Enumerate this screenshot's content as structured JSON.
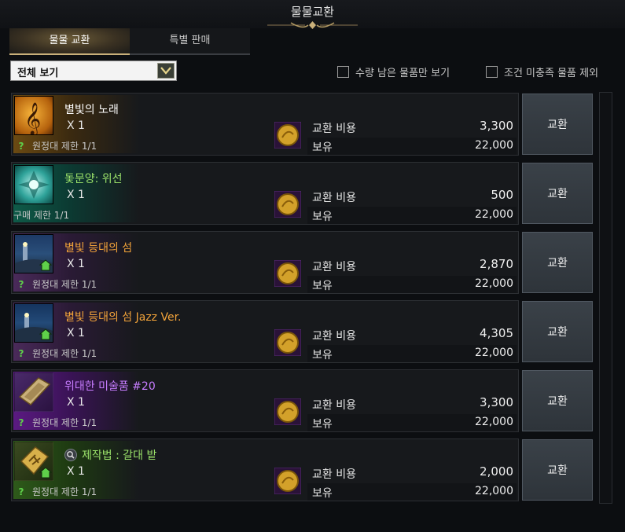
{
  "window": {
    "title": "물물교환"
  },
  "tabs": [
    {
      "label": "물물 교환",
      "active": true
    },
    {
      "label": "특별 판매",
      "active": false
    }
  ],
  "filter": {
    "selected": "전체 보기",
    "checkbox_remaining": "수량 남은 물품만 보기",
    "checkbox_exclude": "조건 미충족 물품 제외"
  },
  "items": [
    {
      "name": "별빛의 노래",
      "qty": "X 1",
      "limit": "원정대 제한 1/1",
      "grade": "legend",
      "name_color": "#ffffff",
      "cost_label": "교환 비용",
      "cost": "3,300",
      "own_label": "보유",
      "owned": "22,000",
      "button": "교환",
      "icon": "treble-clef-icon"
    },
    {
      "name": "돛문양: 위선",
      "qty": "X 1",
      "limit": "구매 제한 1/1",
      "grade": "rare",
      "name_color": "#9be26a",
      "cost_label": "교환 비용",
      "cost": "500",
      "own_label": "보유",
      "owned": "22,000",
      "button": "교환",
      "icon": "sail-pattern-icon"
    },
    {
      "name": "별빛 등대의 섬",
      "qty": "X 1",
      "limit": "원정대 제한 1/1",
      "grade": "epic",
      "name_color": "#f2a33a",
      "cost_label": "교환 비용",
      "cost": "2,870",
      "own_label": "보유",
      "owned": "22,000",
      "button": "교환",
      "icon": "island-icon"
    },
    {
      "name": "별빛 등대의 섬 Jazz Ver.",
      "qty": "X 1",
      "limit": "원정대 제한 1/1",
      "grade": "epic",
      "name_color": "#f2a33a",
      "cost_label": "교환 비용",
      "cost": "4,305",
      "own_label": "보유",
      "owned": "22,000",
      "button": "교환",
      "icon": "island-icon"
    },
    {
      "name": "위대한 미술품 #20",
      "qty": "X 1",
      "limit": "원정대 제한 1/1",
      "grade": "purple",
      "name_color": "#c77dff",
      "cost_label": "교환 비용",
      "cost": "3,300",
      "own_label": "보유",
      "owned": "22,000",
      "button": "교환",
      "icon": "art-scroll-icon"
    },
    {
      "name": "제작법 : 갈대 밭",
      "qty": "X 1",
      "limit": "원정대 제한 1/1",
      "grade": "rare",
      "name_color": "#9be26a",
      "cost_label": "교환 비용",
      "cost": "2,000",
      "own_label": "보유",
      "owned": "22,000",
      "button": "교환",
      "icon": "recipe-icon"
    }
  ]
}
